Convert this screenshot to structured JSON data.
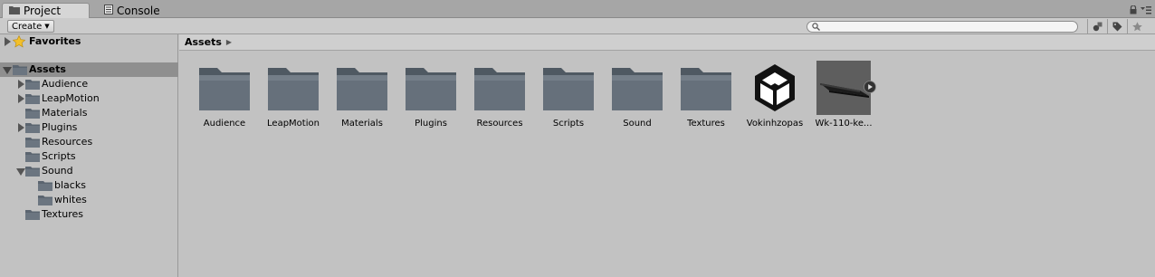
{
  "tabs": [
    {
      "label": "Project",
      "icon": "folder-icon",
      "active": true
    },
    {
      "label": "Console",
      "icon": "console-icon",
      "active": false
    }
  ],
  "toolbar": {
    "create_label": "Create",
    "search_placeholder": ""
  },
  "tree": {
    "favorites_label": "Favorites",
    "assets_label": "Assets",
    "items": [
      {
        "label": "Audience",
        "expandable": true
      },
      {
        "label": "LeapMotion",
        "expandable": true
      },
      {
        "label": "Materials",
        "expandable": false
      },
      {
        "label": "Plugins",
        "expandable": true
      },
      {
        "label": "Resources",
        "expandable": false
      },
      {
        "label": "Scripts",
        "expandable": false
      },
      {
        "label": "Sound",
        "expandable": true,
        "expanded": true
      },
      {
        "label": "blacks",
        "expandable": false
      },
      {
        "label": "whites",
        "expandable": false
      },
      {
        "label": "Textures",
        "expandable": false
      }
    ]
  },
  "breadcrumb": {
    "label": "Assets"
  },
  "assets": [
    {
      "label": "Audience",
      "kind": "folder"
    },
    {
      "label": "LeapMotion",
      "kind": "folder"
    },
    {
      "label": "Materials",
      "kind": "folder"
    },
    {
      "label": "Plugins",
      "kind": "folder"
    },
    {
      "label": "Resources",
      "kind": "folder"
    },
    {
      "label": "Scripts",
      "kind": "folder"
    },
    {
      "label": "Sound",
      "kind": "folder"
    },
    {
      "label": "Textures",
      "kind": "folder"
    },
    {
      "label": "Vokinhzopas",
      "kind": "unity-scene"
    },
    {
      "label": "Wk-110-ke...",
      "kind": "model"
    }
  ],
  "colors": {
    "folder": "#5b6570",
    "selection": "#8f8f8f",
    "background": "#c2c2c2"
  }
}
